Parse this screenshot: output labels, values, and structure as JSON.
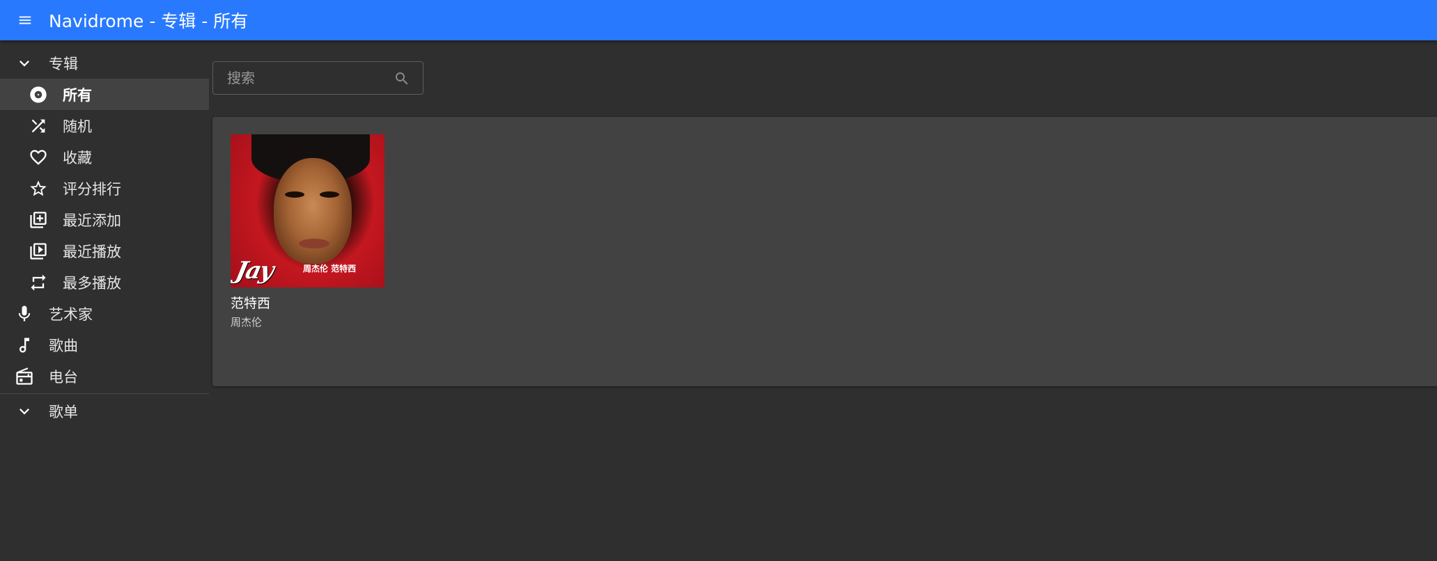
{
  "appbar": {
    "title": "Navidrome - 专辑 - 所有",
    "menu_icon": "menu-icon"
  },
  "sidebar": {
    "albums": {
      "label": "专辑",
      "icon": "chevron-down-icon",
      "items": [
        {
          "label": "所有",
          "icon": "album-disc-icon",
          "active": true
        },
        {
          "label": "随机",
          "icon": "shuffle-icon"
        },
        {
          "label": "收藏",
          "icon": "heart-icon"
        },
        {
          "label": "评分排行",
          "icon": "star-icon"
        },
        {
          "label": "最近添加",
          "icon": "library-add-icon"
        },
        {
          "label": "最近播放",
          "icon": "video-library-icon"
        },
        {
          "label": "最多播放",
          "icon": "repeat-icon"
        }
      ]
    },
    "artists": {
      "label": "艺术家",
      "icon": "microphone-icon"
    },
    "songs": {
      "label": "歌曲",
      "icon": "music-note-icon"
    },
    "radio": {
      "label": "电台",
      "icon": "radio-icon"
    },
    "playlists": {
      "label": "歌单",
      "icon": "chevron-down-icon"
    }
  },
  "search": {
    "placeholder": "搜索",
    "value": "",
    "icon": "search-icon"
  },
  "albums": [
    {
      "title": "范特西",
      "artist": "周杰伦",
      "cover_text": "Jay",
      "cover_text_small": "周杰伦 范特西"
    }
  ],
  "colors": {
    "appbar": "#2879fe",
    "background": "#2f2f2f",
    "panel": "#424242",
    "active_row": "#424242"
  }
}
